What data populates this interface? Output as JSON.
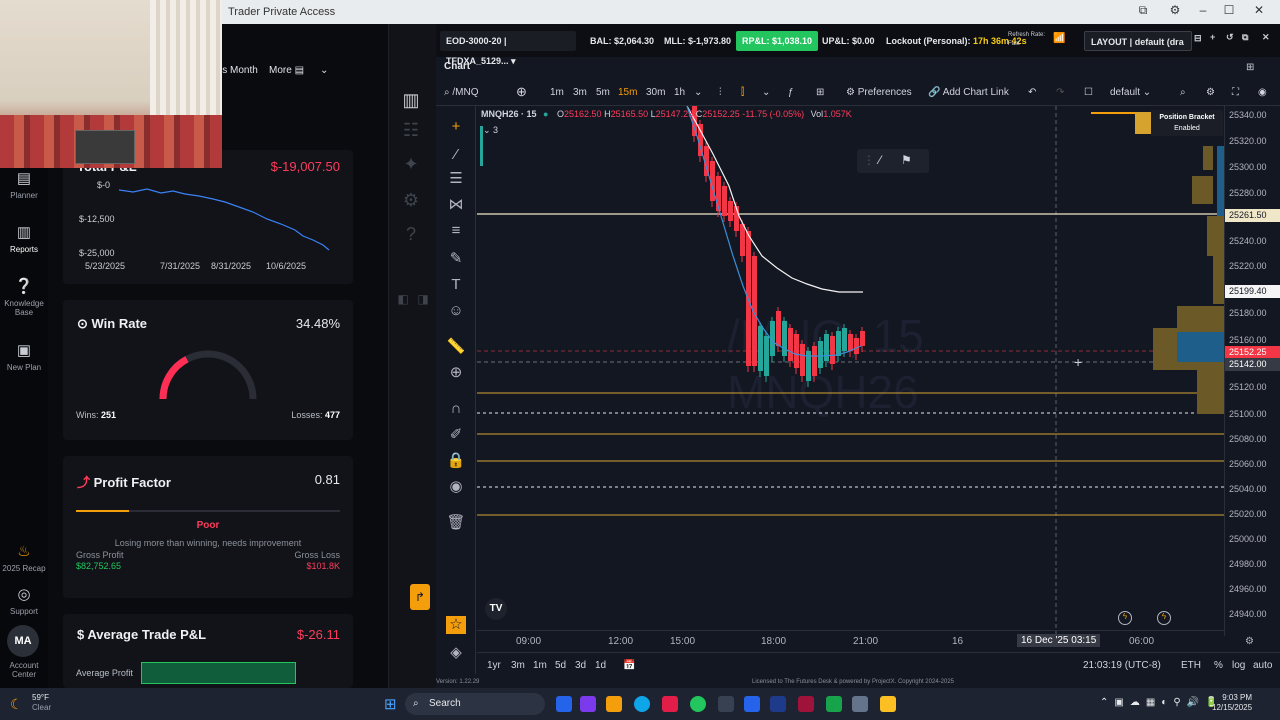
{
  "window": {
    "title": "Trader Private Access"
  },
  "left_nav": {
    "items": [
      {
        "label": "Planner",
        "icon": "book-icon"
      },
      {
        "label": "Reports",
        "icon": "bar-chart-icon"
      },
      {
        "label": "Knowledge Base",
        "icon": "question-icon"
      },
      {
        "label": "New Plan",
        "icon": "plus-doc-icon"
      },
      {
        "label": "2025 Recap",
        "icon": "flame-icon"
      },
      {
        "label": "Support",
        "icon": "support-icon"
      },
      {
        "label": "Account Center",
        "icon": "user-icon"
      }
    ],
    "avatar_initials": "MA"
  },
  "reports": {
    "this_month_label": "is Month",
    "more_label": "More",
    "total_pnl": {
      "title": "Total P&L",
      "value": "$-19,007.50",
      "y_ticks": [
        "$-0",
        "$-12,500",
        "$-25,000"
      ],
      "x_ticks": [
        "5/23/2025",
        "7/31/2025",
        "8/31/2025",
        "10/6/2025"
      ],
      "line_color": "#3b82f6"
    },
    "win_rate": {
      "title": "Win Rate",
      "value": "34.48%",
      "wins_label": "Wins:",
      "wins": "251",
      "losses_label": "Losses:",
      "losses": "477",
      "fraction": 0.3448
    },
    "profit_factor": {
      "title": "Profit Factor",
      "value": "0.81",
      "rating": "Poor",
      "note": "Losing more than winning, needs improvement",
      "gross_profit_label": "Gross Profit",
      "gross_profit": "$82,752.65",
      "gross_loss_label": "Gross Loss",
      "gross_loss": "$101.8K",
      "fraction": 0.2
    },
    "avg_trade": {
      "title": "Average Trade P&L",
      "value": "$-26.11",
      "avg_profit_label": "Average Profit"
    }
  },
  "platform": {
    "account": "EOD-3000-20 | TFDXA_5129...",
    "bal": "BAL: $2,064.30",
    "mll": "MLL: $-1,973.80",
    "rpl": "RP&L: $1,038.10",
    "upl": "UP&L: $0.00",
    "lockout_label": "Lockout (Personal):",
    "lockout_time": "17h 36m 42s",
    "refresh_label": "Refresh Rate:",
    "refresh_value": "Fast",
    "layout": "LAYOUT | default (dra",
    "chart_tab": "Chart",
    "symbol_search": "/MNQ",
    "timeframes": [
      "1m",
      "3m",
      "5m",
      "15m",
      "30m",
      "1h"
    ],
    "active_timeframe": "15m",
    "preferences": "Preferences",
    "add_chart_link": "Add Chart Link",
    "template": "default",
    "legend": {
      "symbol": "MNQH26 · 15",
      "o": "25162.50",
      "h": "25165.50",
      "l": "25147.25",
      "c": "25152.25",
      "change": "-11.75 (-0.05%)",
      "vol": "1.057K",
      "indicator_count": "3"
    },
    "watermark_top": "/MNQ, 15",
    "watermark_bottom": "MNQH26",
    "position_bracket": "Position Bracket",
    "position_bracket_state": "Enabled",
    "price_ticks": [
      "25340.00",
      "25320.00",
      "25300.00",
      "25280.00",
      "25240.00",
      "25220.00",
      "25180.00",
      "25160.00",
      "25120.00",
      "25100.00",
      "25080.00",
      "25060.00",
      "25040.00",
      "25020.00",
      "25000.00",
      "24980.00",
      "24960.00",
      "24940.00"
    ],
    "price_tags": {
      "white_line": "25261.50",
      "ema": "25199.40",
      "last": "25152.25",
      "cursor": "25142.00"
    },
    "time_ticks": [
      "09:00",
      "12:00",
      "15:00",
      "18:00",
      "21:00",
      "16",
      "06:00"
    ],
    "time_cursor": "16 Dec '25  03:15",
    "ranges": [
      "1yr",
      "3m",
      "1m",
      "5d",
      "3d",
      "1d"
    ],
    "clock": "21:03:19 (UTC-8)",
    "instrument": "ETH",
    "log_label": "log",
    "auto_label": "auto",
    "version": "Version: 1.22.29",
    "license": "Licensed to The Futures Desk & powered by ProjectX. Copyright 2024-2025"
  },
  "taskbar": {
    "weather_temp": "59°F",
    "weather_desc": "Clear",
    "search": "Search",
    "time": "9:03 PM",
    "date": "12/15/2025"
  }
}
